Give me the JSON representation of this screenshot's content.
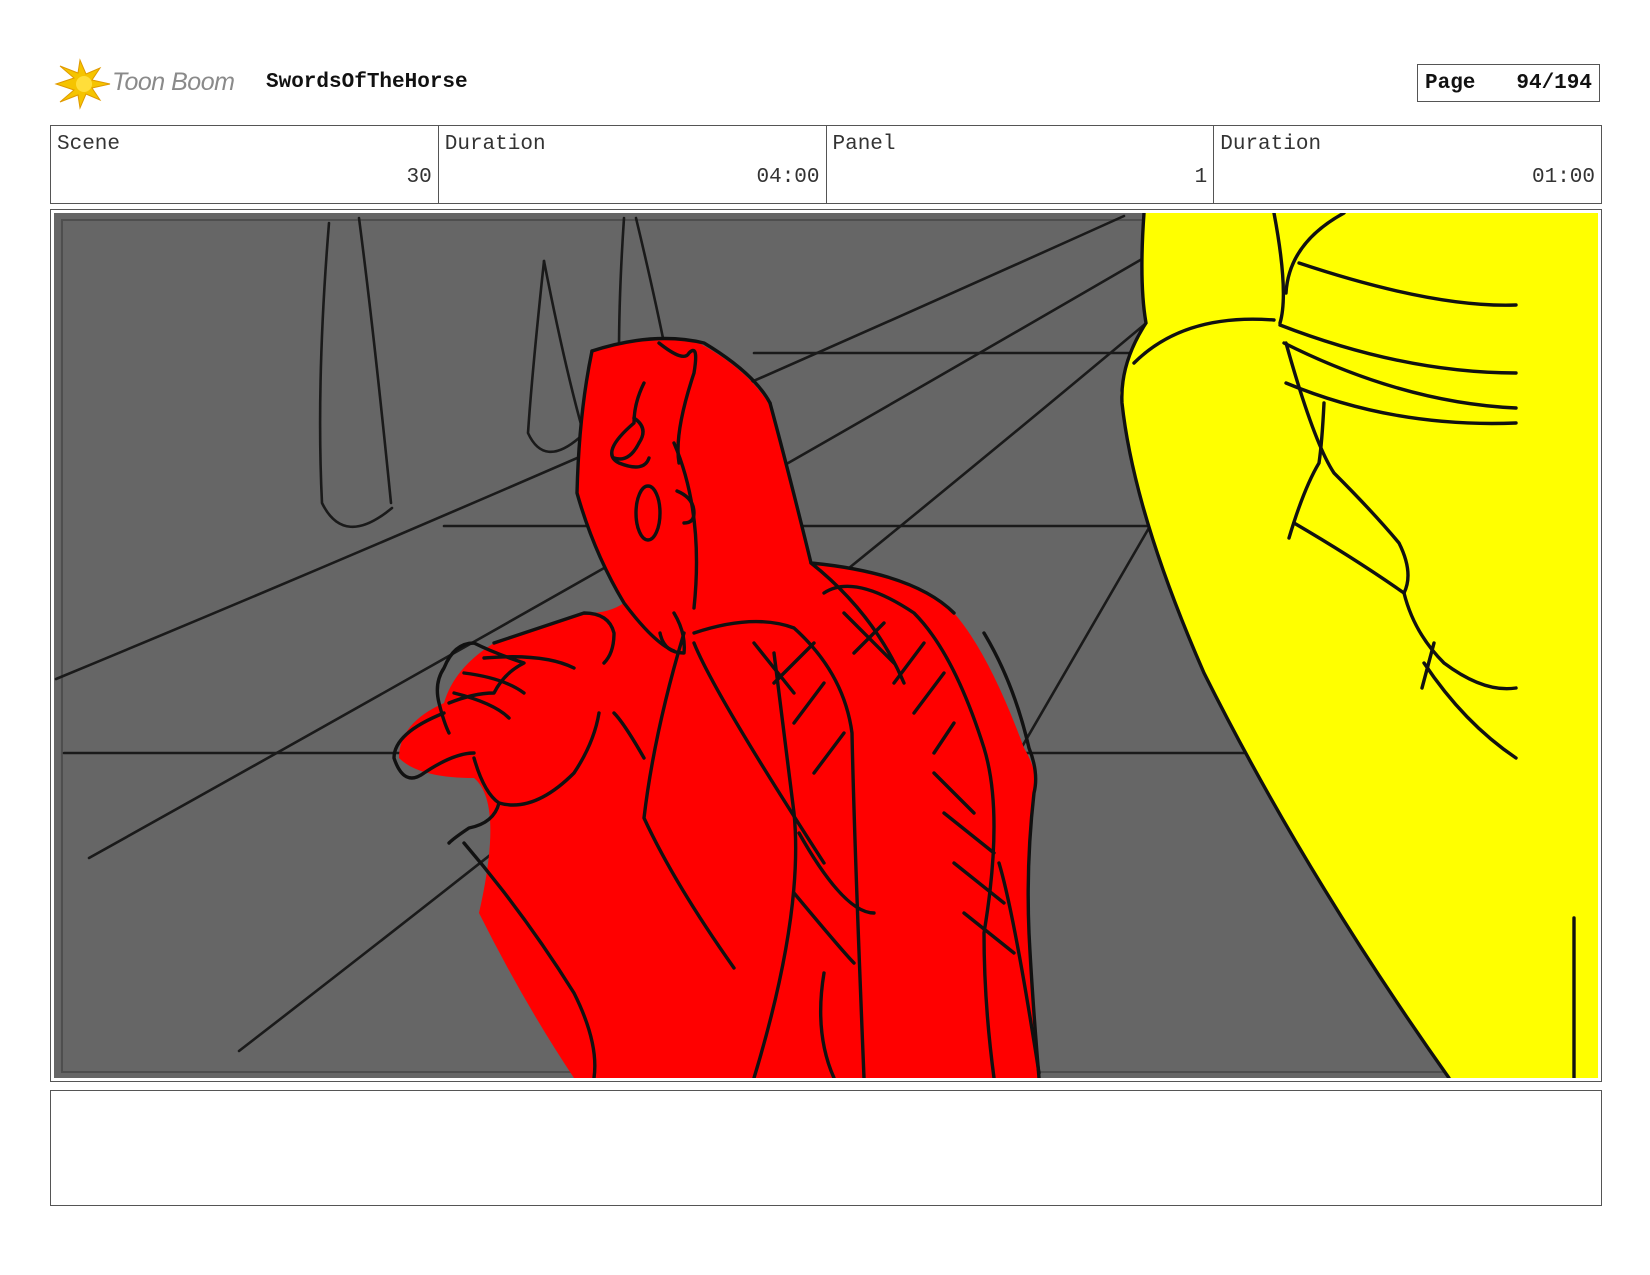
{
  "header": {
    "logo_text": "Toon Boom",
    "project_title": "SwordsOfTheHorse",
    "page_label": "Page",
    "page_number": "94/194"
  },
  "info": {
    "scene_label": "Scene",
    "scene_value": "30",
    "scene_duration_label": "Duration",
    "scene_duration_value": "04:00",
    "panel_label": "Panel",
    "panel_value": "1",
    "panel_duration_label": "Duration",
    "panel_duration_value": "01:00"
  },
  "notes": {
    "text": ""
  },
  "colors": {
    "background_gray": "#666666",
    "character_red": "#ff0000",
    "character_yellow": "#ffff00",
    "line_black": "#111111",
    "logo_yellow": "#f5c400"
  }
}
